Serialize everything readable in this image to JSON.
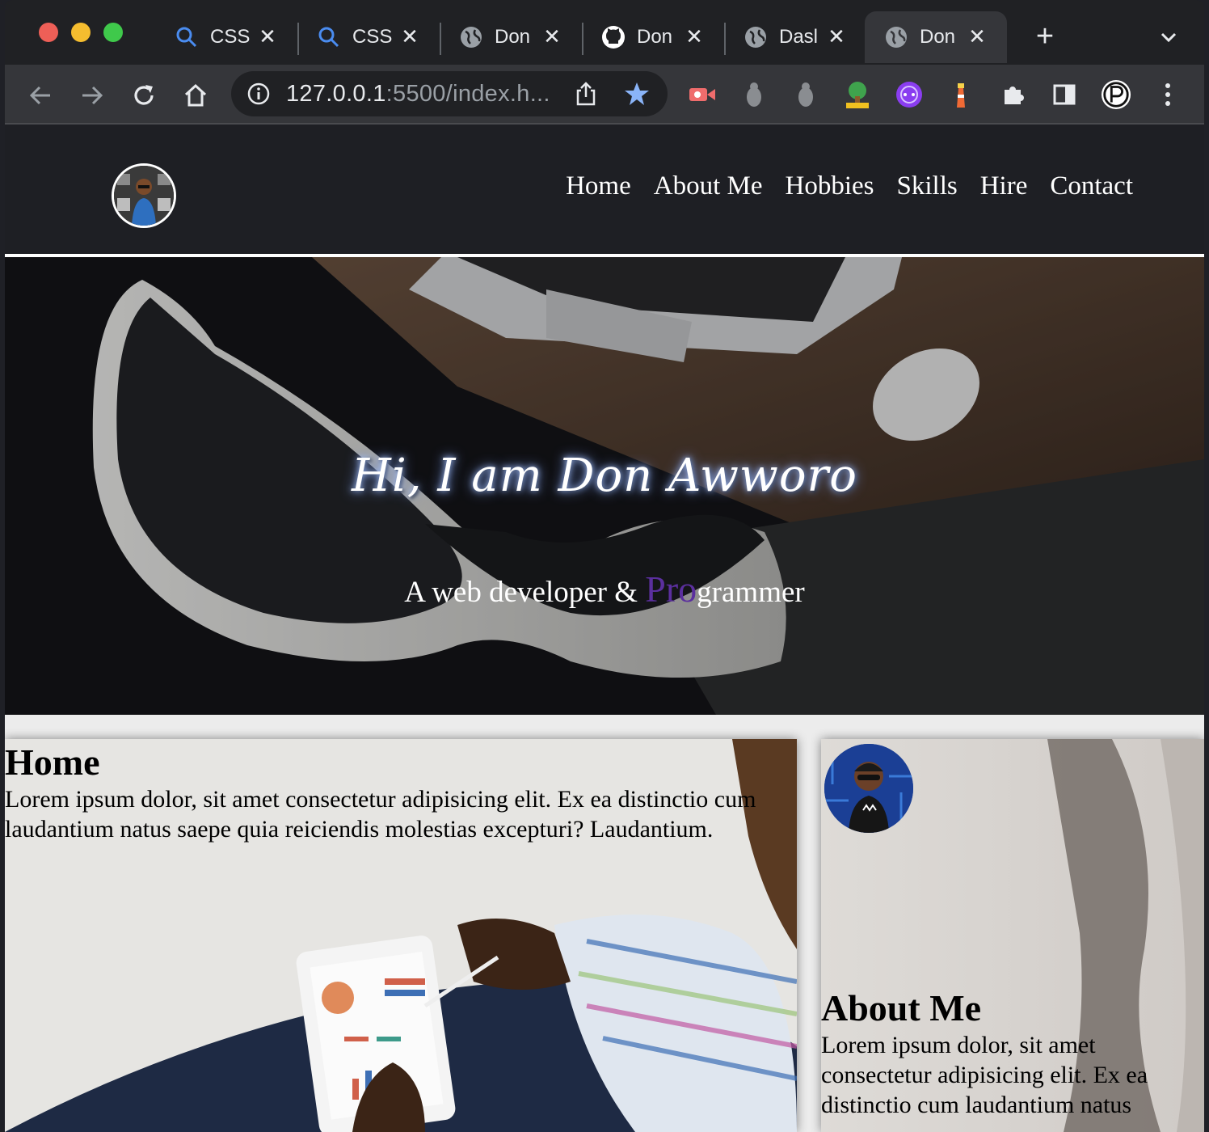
{
  "browser": {
    "tabs": [
      {
        "icon": "search-icon",
        "label": "CSS"
      },
      {
        "icon": "search-icon",
        "label": "CSS"
      },
      {
        "icon": "globe-icon",
        "label": "Don"
      },
      {
        "icon": "github-icon",
        "label": "Don"
      },
      {
        "icon": "globe-icon",
        "label": "Dasl"
      },
      {
        "icon": "globe-icon",
        "label": "Don",
        "active": true
      }
    ],
    "url_host": "127.0.0.1",
    "url_rest": ":5500/index.h..."
  },
  "site": {
    "nav": [
      "Home",
      "About Me",
      "Hobbies",
      "Skills",
      "Hire",
      "Contact"
    ],
    "hero_title": "Hi, I am Don Awworo",
    "hero_sub_prefix": "A web developer & ",
    "hero_sub_highlight": "Pro",
    "hero_sub_suffix": "grammer",
    "home": {
      "title": "Home",
      "body": "Lorem ipsum dolor, sit amet consectetur adipisicing elit. Ex ea distinctio cum laudantium natus saepe quia reiciendis molestias excepturi? Laudantium."
    },
    "about": {
      "title": "About Me",
      "body": "Lorem ipsum dolor, sit amet consectetur adipisicing elit. Ex ea distinctio cum laudantium natus"
    }
  },
  "colors": {
    "highlight": "#5b2f9e",
    "header_bg": "#1e1f24"
  }
}
